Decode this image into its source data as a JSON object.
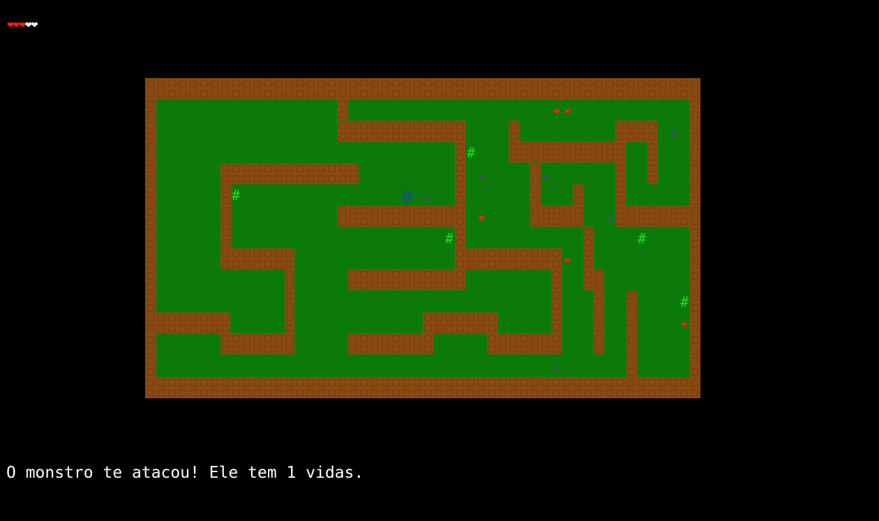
{
  "hud": {
    "health_hearts": "❤❤❤❤❤",
    "health_current": 3,
    "health_max": 5
  },
  "colors": {
    "floor": "#0b7a0b",
    "wall": "#8a4a12",
    "wall_inner": "#6e3a0c",
    "heart": "#ff1a1a",
    "heart_empty": "#ffffff",
    "monster": "#6a3aa0",
    "player": "#1f3cb0",
    "door": "#22dd22",
    "background": "#000000"
  },
  "map": {
    "rows": [
      "##########################################################",
      "#                  #                    HH              #",
      "#                  ############    #         ####    M  #",
      "#                           H#    ###########  #  #    #",
      "#      ###############      #  M  ##M    #  #        #",
      "#      #H          @ M      #     #    #   #        #",
      "#      #          ############  H   ######  M######",
      "#      #                 H#              #  #   H     #",
      "#      #######             ##########   H #          #",
      "#            #  ##########          #    ##         #",
      "#            #                      #     #   #  H   #",
      "########     #         #######     #     #   #    H#",
      "#      ######    ########    ######     #   #      #",
      "#                                   M        #      #",
      "##########################################################"
    ],
    "legend": {
      "#": "wall",
      " ": "floor",
      "@": "player",
      "M": "monster",
      "H": "heart",
      "D": "door"
    }
  },
  "entities": {
    "player_glyph": "@",
    "monster_glyph": "☠",
    "heart_glyph": "❤",
    "door_glyph": "#"
  },
  "message": "O monstro te atacou! Ele tem 1 vidas."
}
